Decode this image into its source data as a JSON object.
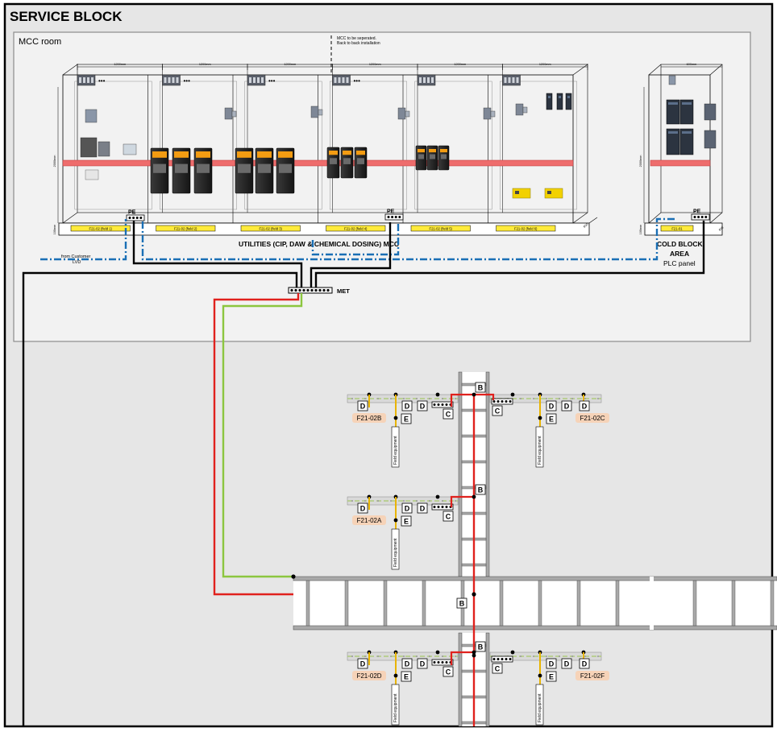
{
  "title": "SERVICE BLOCK",
  "mcc_room": "MCC room",
  "note_line1": "MCC to be seperated.",
  "note_line2": "Back to back installation",
  "mcc_caption": "UTILITIES (CIP, DAW & CHEMICAL DOSING) MCC",
  "pe": "PE",
  "from_customer_line1": "from Customer",
  "from_customer_line2": "LVD",
  "cold_block_line1": "COLD BLOCK",
  "cold_block_line2": "AREA",
  "plc_panel": "PLC panel",
  "met": "MET",
  "dim_1200": "1200mm",
  "dim_600": "600mm",
  "dim_height": "2000mm",
  "dim_base": "100mm",
  "dim_depth": "600",
  "field_labels": [
    "F21-02 (field 1)",
    "F21-02 (field 2)",
    "F21-02 (field 3)",
    "F21-02 (field 4)",
    "F21-02 (field 5)",
    "F21-02 (field 6)"
  ],
  "plc_field": "F21-01",
  "dots": "•••",
  "letters": {
    "B": "B",
    "C": "C",
    "D": "D",
    "E": "E"
  },
  "field_equipment": "Field equipment",
  "bars": [
    {
      "left": "F21-02B",
      "right": "F21-02C"
    },
    {
      "left": "F21-02A",
      "right": ""
    },
    {
      "left": "F21-02D",
      "right": "F21-02F"
    }
  ],
  "colors": {
    "phase": "#e0211d",
    "earth": "#8cc63f",
    "signal": "#1a6fb5",
    "tag": "#f6d3b8",
    "ladder": "#a9a9a9"
  }
}
